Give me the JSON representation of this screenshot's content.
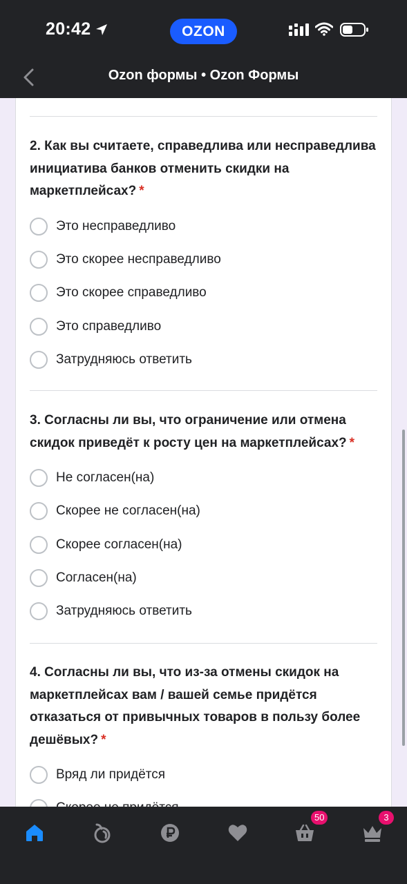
{
  "status_bar": {
    "time": "20:42",
    "app_badge": "OZON",
    "icons": [
      "location-arrow-icon",
      "signal-icon",
      "wifi-icon",
      "battery-icon"
    ]
  },
  "nav": {
    "title": "Ozon формы • Ozon Формы",
    "back_icon": "chevron-left-icon"
  },
  "questions": [
    {
      "title": "2. Как вы считаете, справедлива или несправедлива инициатива банков отменить скидки на маркетплейсах?",
      "required_mark": "*",
      "options": [
        "Это несправедливо",
        "Это скорее несправедливо",
        "Это скорее справедливо",
        "Это справедливо",
        "Затрудняюсь ответить"
      ]
    },
    {
      "title": "3. Согласны ли вы, что ограничение или отмена скидок приведёт к росту цен на маркетплейсах?",
      "required_mark": "*",
      "options": [
        "Не согласен(на)",
        "Скорее не согласен(на)",
        "Скорее согласен(на)",
        "Согласен(на)",
        "Затрудняюсь ответить"
      ]
    },
    {
      "title": "4. Согласны ли вы, что из-за отмены скидок на маркетплейсах вам / вашей семье придётся отказаться от привычных товаров в пользу более дешёвых?",
      "required_mark": "*",
      "options": [
        "Вряд ли придётся",
        "Скорее не придётся"
      ]
    }
  ],
  "tabbar": {
    "tabs": [
      {
        "name": "home-icon",
        "active": true
      },
      {
        "name": "fresh-icon",
        "active": false
      },
      {
        "name": "ruble-icon",
        "active": false
      },
      {
        "name": "favorites-heart-icon",
        "active": false
      },
      {
        "name": "cart-icon",
        "active": false,
        "badge": "50"
      },
      {
        "name": "profile-crown-icon",
        "active": false,
        "badge": "3"
      }
    ]
  },
  "colors": {
    "accent": "#1a5cff",
    "required": "#d93025",
    "badge": "#e8106e",
    "bar_background": "#222326",
    "active_tab": "#1a8cff"
  }
}
